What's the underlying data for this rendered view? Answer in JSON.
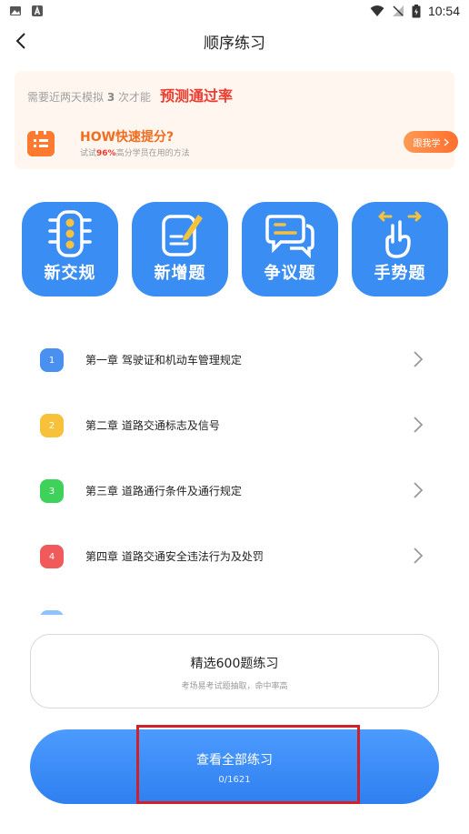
{
  "status_bar": {
    "time": "10:54",
    "left_icons": [
      "image-icon",
      "a-icon"
    ],
    "right_icons": [
      "wifi-icon",
      "no-signal-icon",
      "battery-icon"
    ]
  },
  "header": {
    "title": "顺序练习"
  },
  "promo": {
    "hint_pre": "需要近两天模拟 ",
    "hint_num": "3",
    "hint_post": " 次才能",
    "hint_strong": "预测通过率",
    "tip_title": "HOW快速提分?",
    "tip_sub_pre": "试试",
    "tip_sub_pct": "96%",
    "tip_sub_post": "高分学员在用的方法",
    "button": "跟我学",
    "accent": "#ff7a2f"
  },
  "tiles": [
    {
      "label": "新交规",
      "icon": "traffic-light-icon"
    },
    {
      "label": "新增题",
      "icon": "edit-note-icon"
    },
    {
      "label": "争议题",
      "icon": "chat-bubbles-icon"
    },
    {
      "label": "手势题",
      "icon": "hand-gesture-icon"
    }
  ],
  "chapters": [
    {
      "num": "1",
      "label": "第一章  驾驶证和机动车管理规定",
      "color": "#4a90f0"
    },
    {
      "num": "2",
      "label": "第二章  道路交通标志及信号",
      "color": "#f7c23a"
    },
    {
      "num": "3",
      "label": "第三章  道路通行条件及通行规定",
      "color": "#3fd25a"
    },
    {
      "num": "4",
      "label": "第四章  道路交通安全违法行为及处罚",
      "color": "#f05a5a"
    },
    {
      "num": "",
      "label": "",
      "color": "#8ec3ff"
    }
  ],
  "selected": {
    "title": "精选600题练习",
    "subtitle": "考场易考试题抽取，命中率高"
  },
  "all_practice": {
    "title": "查看全部练习",
    "count": "0/1621"
  },
  "colors": {
    "primary": "#3a8df3",
    "highlight": "#d0212b"
  }
}
